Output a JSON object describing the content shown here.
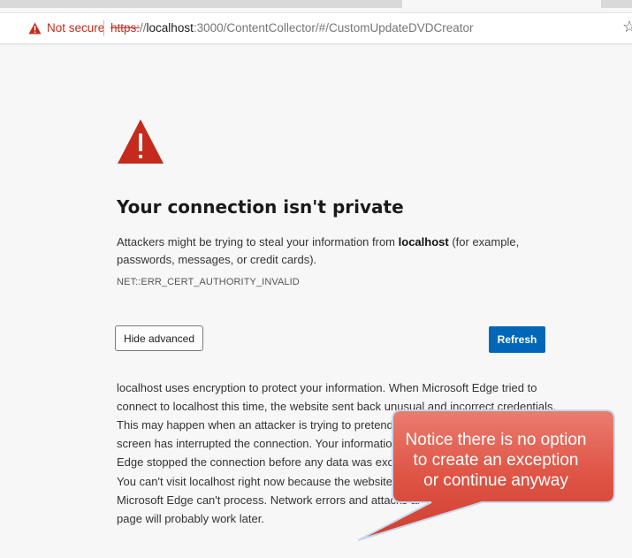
{
  "browser": {
    "security_label": "Not secure",
    "url_scheme": "https:",
    "url_slashes": "//",
    "url_host": "localhost",
    "url_rest": ":3000/ContentCollector/#/CustomUpdateDVDCreator"
  },
  "error_page": {
    "title": "Your connection isn't private",
    "description_before": "Attackers might be trying to steal your information from ",
    "description_host": "localhost",
    "description_after": " (for example, passwords, messages, or credit cards).",
    "error_code": "NET::ERR_CERT_AUTHORITY_INVALID",
    "hide_advanced_label": "Hide advanced",
    "refresh_label": "Refresh",
    "advanced_paragraph_lines": [
      "localhost uses encryption to protect your information. When Microsoft Edge tried to",
      "connect to localhost this time, the website sent back unusual and incorrect credentials.",
      "This may happen when an attacker is trying to pretend to be",
      "screen has interrupted the connection. Your information is",
      "Edge stopped the connection before any data was exchan"
    ],
    "visit_paragraph_lines": [
      "You can't visit localhost right now because the website sen",
      "Microsoft Edge can't process. Network errors and attacks ar",
      "page will probably work later."
    ]
  },
  "callout": {
    "lines": [
      "Notice there is no option",
      "to create an exception",
      "or continue anyway"
    ]
  },
  "colors": {
    "warning_red": "#c42b1c",
    "refresh_blue": "#0067b8",
    "callout_red": "#e05a4c"
  }
}
